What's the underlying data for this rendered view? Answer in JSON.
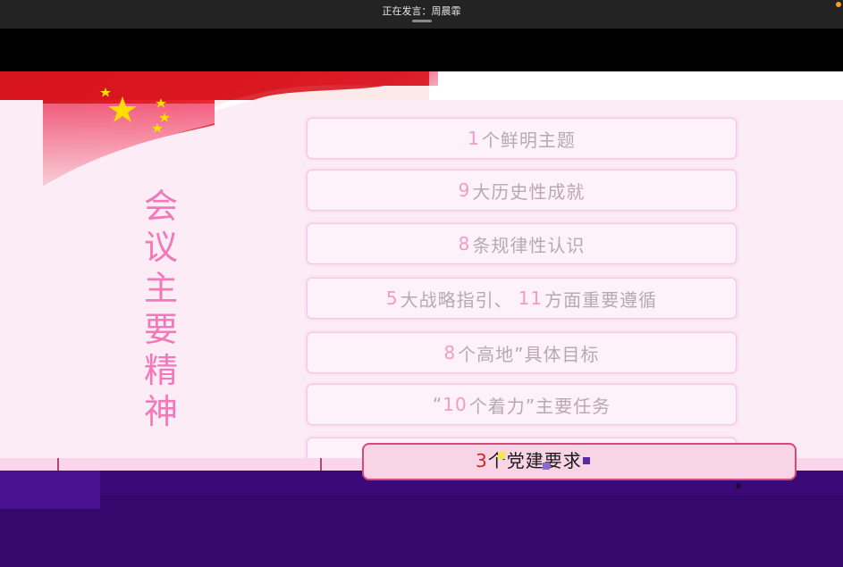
{
  "meeting": {
    "speaking_label": "正在发言：周晨霏"
  },
  "slide": {
    "vertical_title": [
      "会",
      "议",
      "主",
      "要",
      "精",
      "神"
    ],
    "items": [
      {
        "num": "1",
        "text": "个鲜明主题"
      },
      {
        "num": "9",
        "text": "大历史性成就"
      },
      {
        "num": "8",
        "text": "条规律性认识"
      },
      {
        "num": "5",
        "text": "大战略指引、",
        "num2": "11",
        "text2": "方面重要遵循"
      },
      {
        "num": "8",
        "text": "个高地”具体目标"
      },
      {
        "prefix": "“",
        "num": "10",
        "text": "个着力”主要任务"
      }
    ],
    "bottom_banner": {
      "num": "3",
      "text": "个党建要求"
    }
  },
  "colors": {
    "topbar": "#232323",
    "slide_bg": "#fcecf6",
    "title_pink": "#f279b8",
    "number_pink": "#f59ac8",
    "item_text": "#b9a8b3",
    "flag_red": "#e8202a",
    "star_yellow": "#ffde00",
    "purple": "#35086e"
  },
  "icons": [
    "five-star-flag-icon",
    "recording-dot-icon"
  ]
}
